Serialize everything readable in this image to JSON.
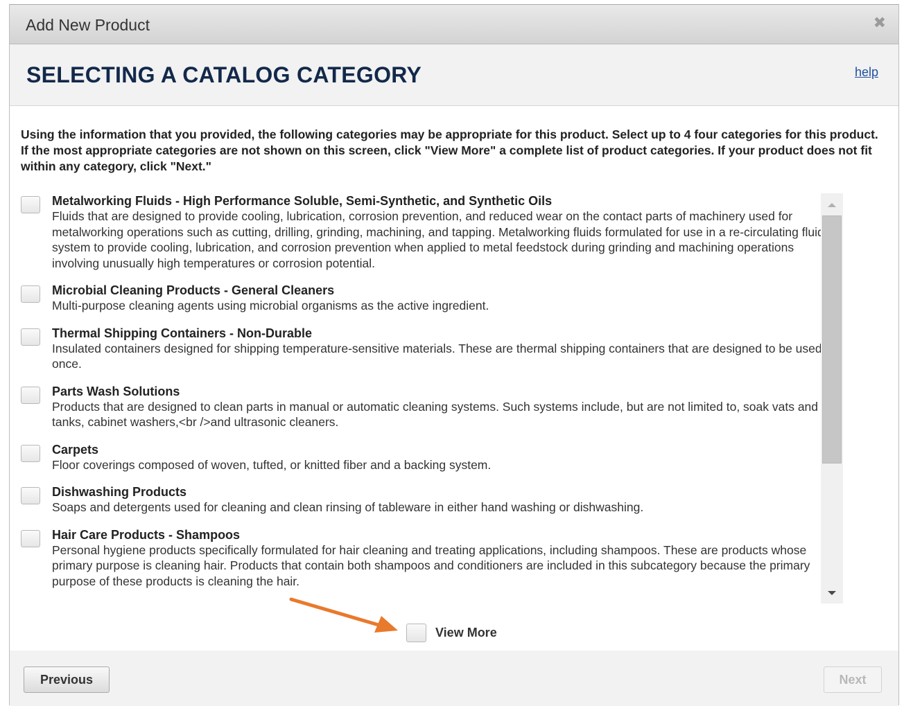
{
  "dialog": {
    "title": "Add New Product",
    "close_glyph": "✖"
  },
  "header": {
    "heading": "SELECTING A CATALOG CATEGORY",
    "help_link": "help"
  },
  "instructions": "Using the information that you provided, the following categories may be appropriate for this product. Select up to 4 four categories for this product. If the most appropriate categories are not shown on this screen, click \"View More\" a complete list of product categories. If your product does not fit within any category, click \"Next.\"",
  "categories": [
    {
      "name": "Metalworking Fluids - High Performance Soluble, Semi-Synthetic, and Synthetic Oils",
      "description": "Fluids that are designed to provide cooling, lubrication, corrosion prevention, and reduced wear on the contact parts of machinery used for metalworking operations such as cutting, drilling, grinding, machining, and tapping. Metalworking fluids formulated for use in a re-circulating fluid system to provide cooling, lubrication, and corrosion prevention when applied to metal feedstock during grinding and machining operations involving unusually high temperatures or corrosion potential."
    },
    {
      "name": "Microbial Cleaning Products - General Cleaners",
      "description": "Multi-purpose cleaning agents using microbial organisms as the active ingredient."
    },
    {
      "name": "Thermal Shipping Containers - Non-Durable",
      "description": "Insulated containers designed for shipping temperature-sensitive materials. These are thermal shipping containers that are designed to be used once."
    },
    {
      "name": "Parts Wash Solutions",
      "description": "Products that are designed to clean parts in manual or automatic cleaning systems. Such systems include, but are not limited to, soak vats and tanks, cabinet washers,<br />and ultrasonic cleaners."
    },
    {
      "name": "Carpets",
      "description": "Floor coverings composed of woven, tufted, or knitted fiber and a backing system."
    },
    {
      "name": "Dishwashing Products",
      "description": "Soaps and detergents used for cleaning and clean rinsing of tableware in either hand washing or dishwashing."
    },
    {
      "name": "Hair Care Products - Shampoos",
      "description": "Personal hygiene products specifically formulated for hair cleaning and treating applications, including shampoos. These are products whose primary purpose is cleaning hair. Products that contain both shampoos and conditioners are included in this subcategory because the primary purpose of these products is cleaning the hair."
    }
  ],
  "view_more_label": "View More",
  "buttons": {
    "previous": "Previous",
    "next": "Next"
  },
  "colors": {
    "heading": "#13294b",
    "link": "#1f4fa0",
    "annotation_arrow": "#e87a2c"
  },
  "icons": {
    "close": "close-icon",
    "scroll_up": "scroll-up-arrow-icon",
    "scroll_down": "scroll-down-arrow-icon",
    "annotation": "annotation-arrow-icon"
  }
}
